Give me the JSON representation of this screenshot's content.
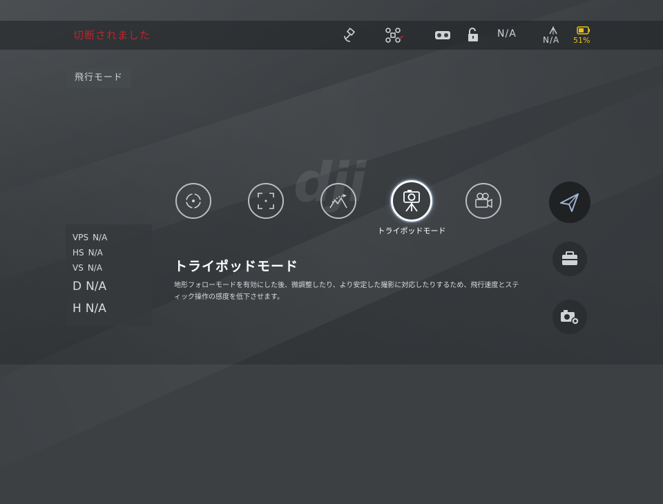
{
  "topbar": {
    "status_text": "切断されました",
    "signal_value": "N/A",
    "height_value": "N/A",
    "battery_percent": "51%",
    "icons": [
      "satellite-icon",
      "aircraft-icon",
      "vr-goggles-icon",
      "unlock-icon",
      "height-icon",
      "battery-icon"
    ]
  },
  "flight_mode_badge": "飛行モード",
  "telemetry": {
    "vps_label": "VPS",
    "vps_value": "N/A",
    "hs_label": "HS",
    "hs_value": "N/A",
    "vs_label": "VS",
    "vs_value": "N/A",
    "d_label": "D",
    "d_value": "N/A",
    "h_label": "H",
    "h_value": "N/A"
  },
  "logo": "dji",
  "modes": {
    "selected_caption": "トライポッドモード",
    "icons": [
      "point-of-interest-icon",
      "tapfly-icon",
      "terrain-follow-icon",
      "tripod-icon",
      "cinematic-icon"
    ]
  },
  "description": {
    "title": "トライポッドモード",
    "body": "地形フォローモードを有効にした後、微調整したり、より安定した撮影に対応したりするため、飛行速度とスティック操作の感度を低下させます。"
  },
  "side_buttons": [
    "send-icon",
    "toolbox-icon",
    "camera-settings-icon"
  ],
  "colors": {
    "accent_red": "#c0242c",
    "battery_yellow": "#e8c21a",
    "background": "#3c4043"
  }
}
